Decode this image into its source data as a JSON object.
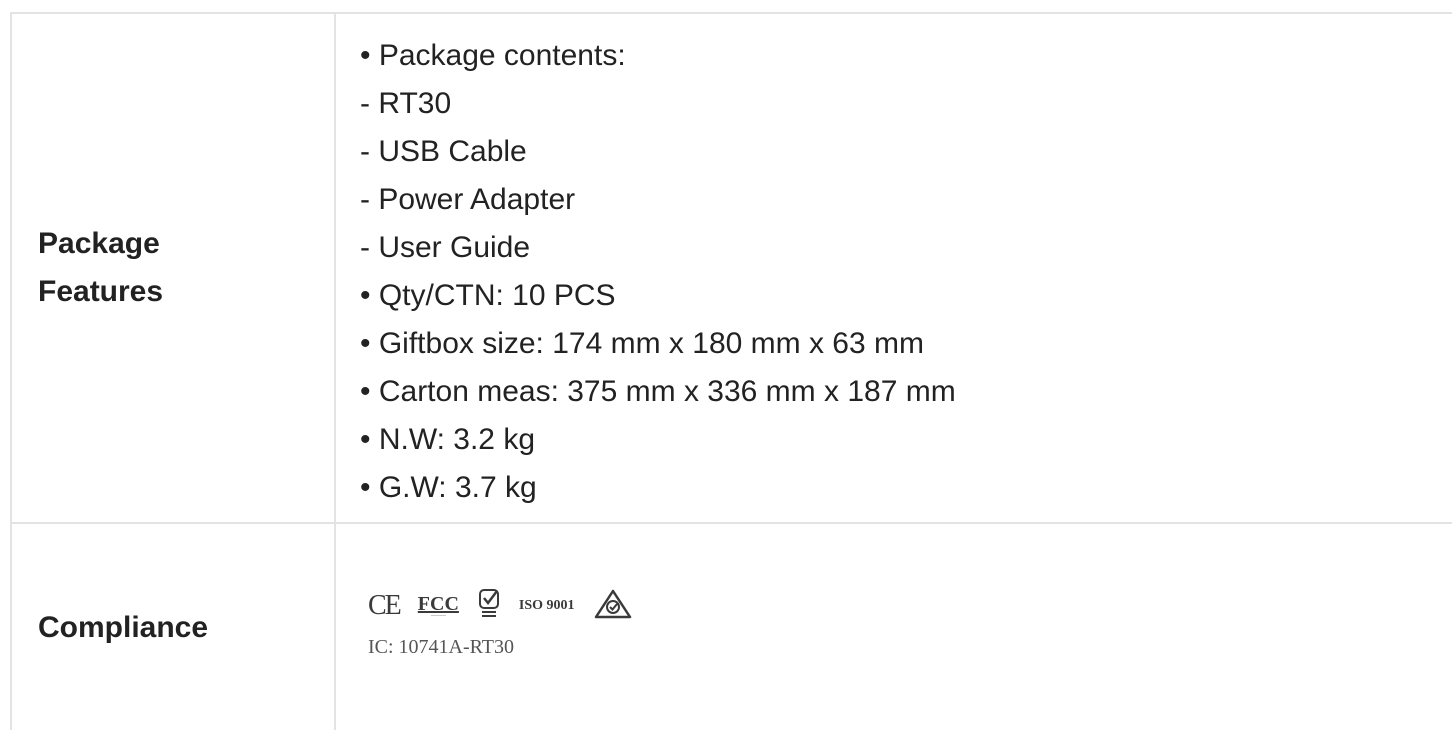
{
  "rows": [
    {
      "label_line1": "Package",
      "label_line2": "Features",
      "items": [
        "• Package contents:",
        "- RT30",
        "- USB Cable",
        "- Power Adapter",
        "- User Guide",
        "• Qty/CTN: 10 PCS",
        "• Giftbox size: 174 mm x 180 mm x 63 mm",
        "• Carton meas: 375 mm x 336 mm x 187 mm",
        "• N.W: 3.2 kg",
        "• G.W: 3.7 kg"
      ]
    },
    {
      "label": "Compliance",
      "logos": {
        "ce": "CE",
        "fcc": "FCC",
        "iso": "ISO 9001"
      },
      "ic_text": "IC: 10741A-RT30"
    }
  ],
  "icons": [
    "ce-mark-icon",
    "fcc-mark-icon",
    "check-certification-icon",
    "rcm-mark-icon"
  ],
  "colors": {
    "border": "#e3e3e3",
    "text": "#222222"
  }
}
